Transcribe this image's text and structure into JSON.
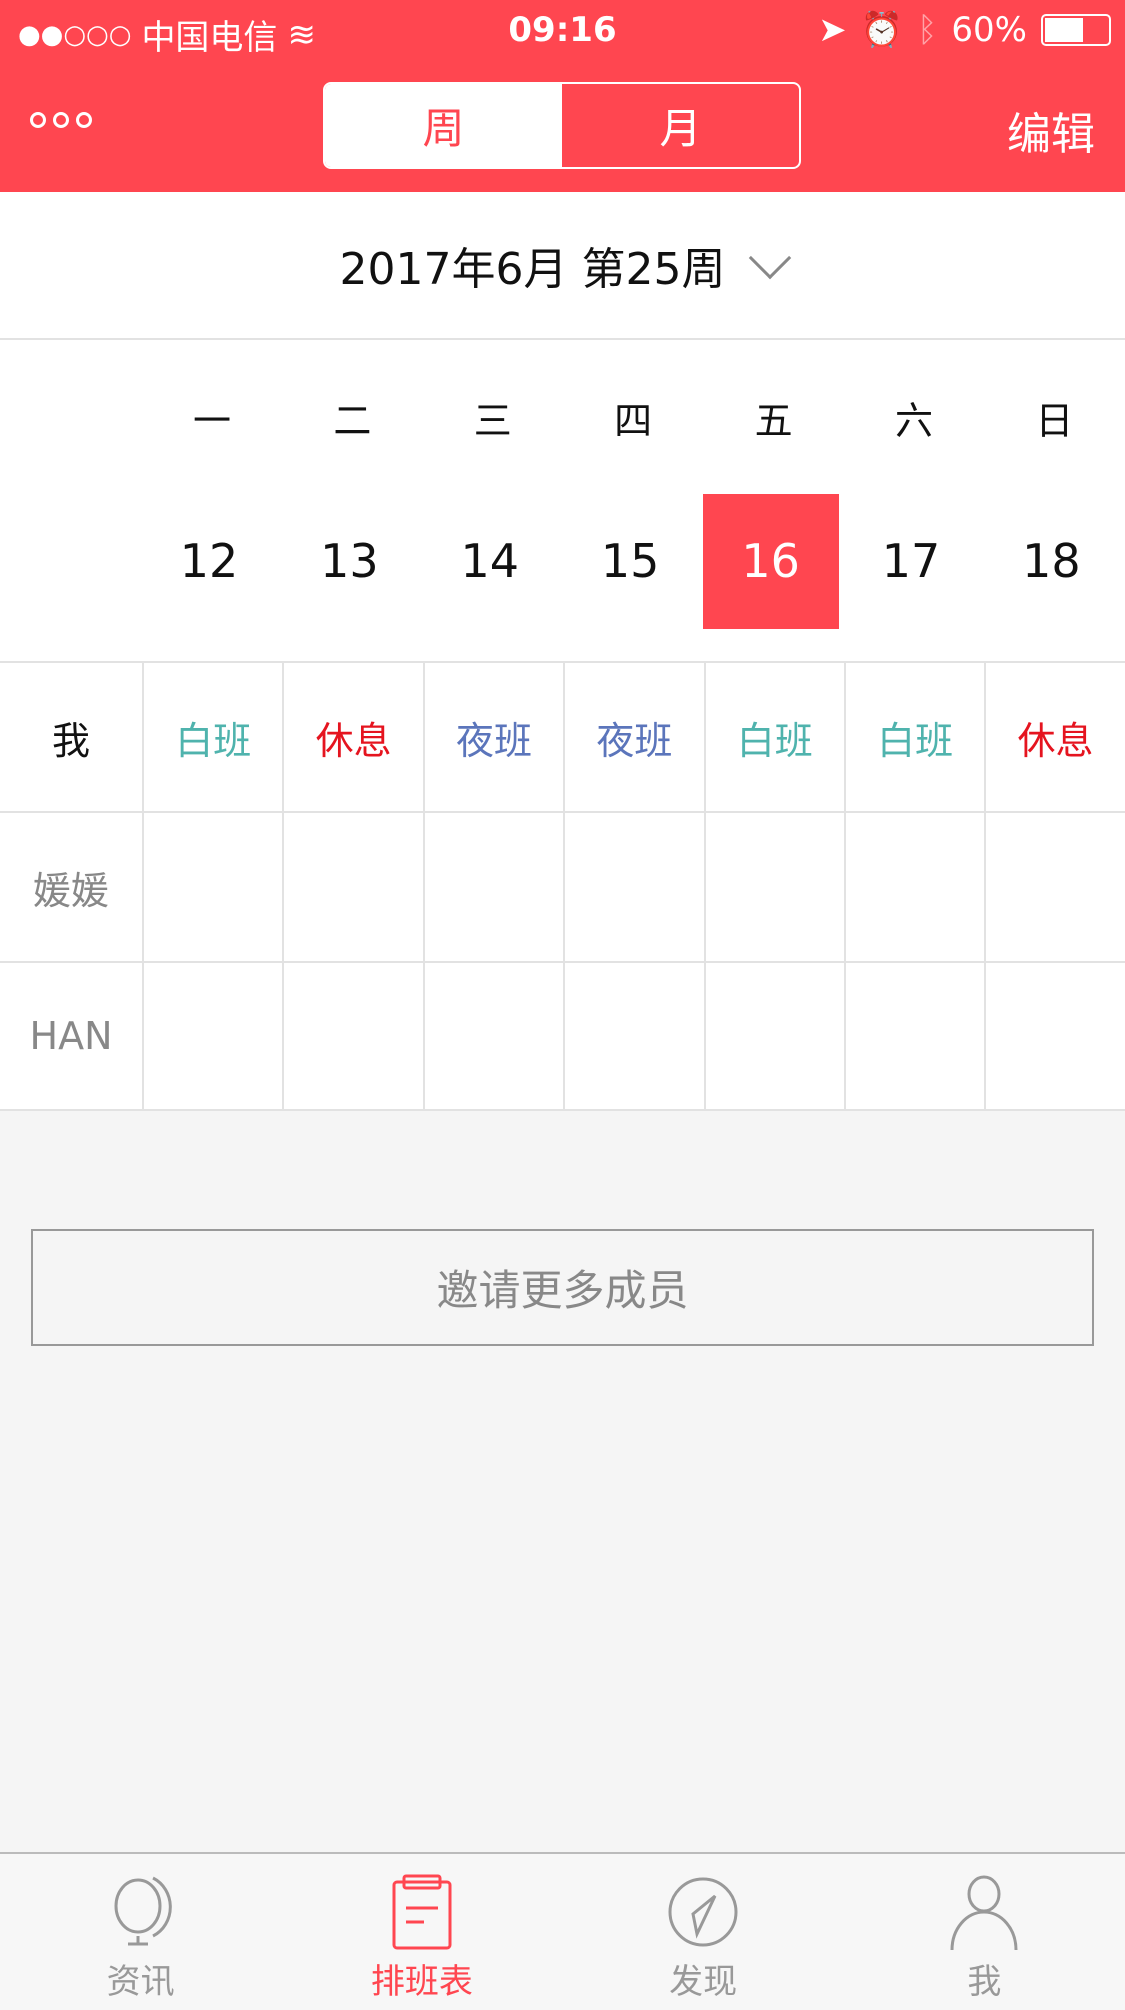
{
  "status": {
    "signal": "●●○○○",
    "carrier": "中国电信",
    "time": "09:16",
    "battery": "60%",
    "battery_level": 0.6
  },
  "header": {
    "segments": [
      "周",
      "月"
    ],
    "active_segment": 0,
    "edit": "编辑"
  },
  "period": {
    "title": "2017年6月 第25周"
  },
  "week": {
    "weekdays": [
      "一",
      "二",
      "三",
      "四",
      "五",
      "六",
      "日"
    ],
    "dates": [
      "12",
      "13",
      "14",
      "15",
      "16",
      "17",
      "18"
    ],
    "selected_index": 4
  },
  "colors": {
    "accent": "#ff4650",
    "day_shift": "#4fb3ad",
    "night_shift": "#5b75bb",
    "rest": "#e5141f"
  },
  "rows": [
    {
      "name": "我",
      "shifts": [
        "白班",
        "休息",
        "夜班",
        "夜班",
        "白班",
        "白班",
        "休息"
      ]
    },
    {
      "name": "媛媛",
      "shifts": [
        "",
        "",
        "",
        "",
        "",
        "",
        ""
      ]
    },
    {
      "name": "HAN",
      "shifts": [
        "",
        "",
        "",
        "",
        "",
        "",
        ""
      ]
    }
  ],
  "invite": "邀请更多成员",
  "tabs": [
    {
      "label": "资讯",
      "icon": "globe-icon"
    },
    {
      "label": "排班表",
      "icon": "clipboard-icon"
    },
    {
      "label": "发现",
      "icon": "compass-icon"
    },
    {
      "label": "我",
      "icon": "person-icon"
    }
  ],
  "active_tab": 1
}
